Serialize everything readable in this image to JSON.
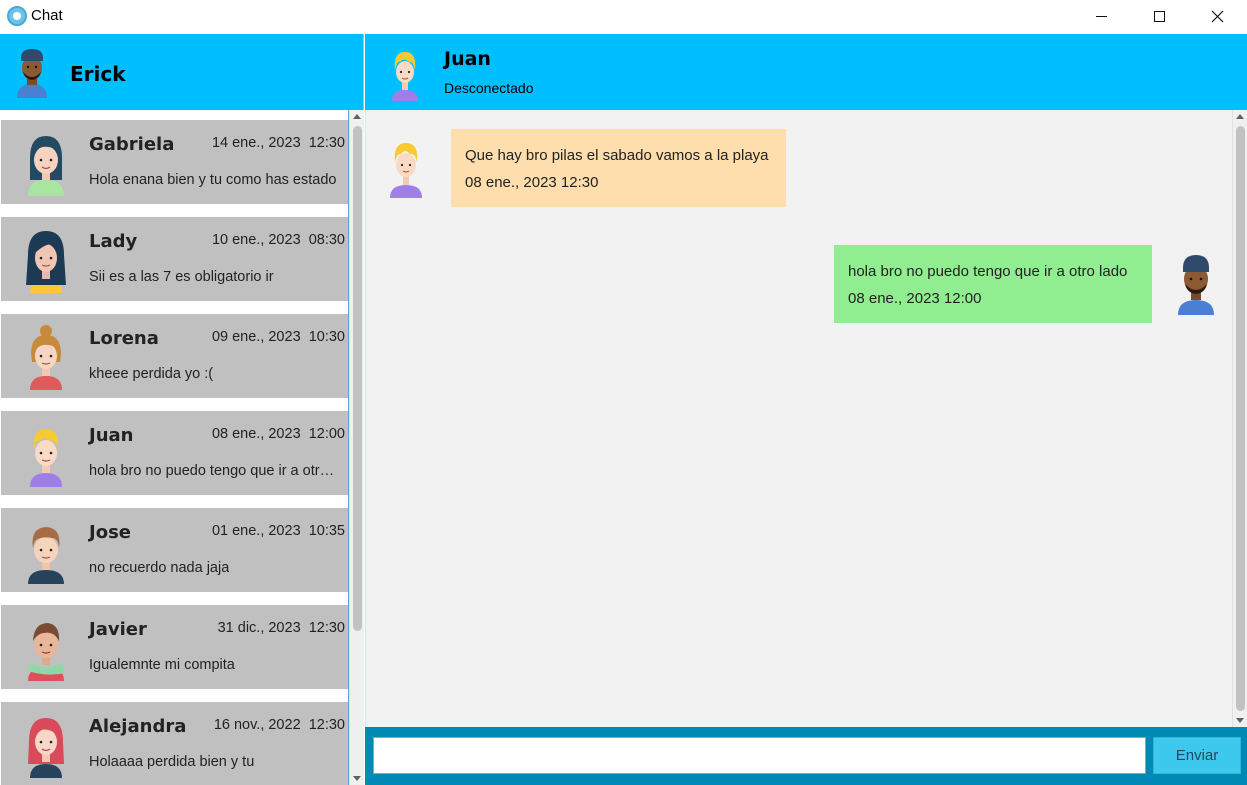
{
  "window": {
    "title": "Chat"
  },
  "current_user": {
    "name": "Erick",
    "avatar": "man-beanie-avatar"
  },
  "contacts": [
    {
      "name": "Gabriela",
      "date": "14 ene., 2023",
      "time": "12:30",
      "last_message": "Hola enana bien y tu como has estado",
      "avatar": "woman-dark-hair-avatar"
    },
    {
      "name": "Lady",
      "date": "10 ene., 2023",
      "time": "08:30",
      "last_message": "Sii es a las 7 es obligatorio ir",
      "avatar": "woman-long-hair-avatar"
    },
    {
      "name": "Lorena",
      "date": "09 ene., 2023",
      "time": "10:30",
      "last_message": "kheee perdida yo :(",
      "avatar": "woman-bun-avatar"
    },
    {
      "name": "Juan",
      "date": "08 ene., 2023",
      "time": "12:00",
      "last_message": "hola bro no puedo tengo que ir a otro ...",
      "avatar": "blond-man-avatar"
    },
    {
      "name": "Jose",
      "date": "01 ene., 2023",
      "time": "10:35",
      "last_message": "no recuerdo nada jaja",
      "avatar": "man-brown-hair-avatar"
    },
    {
      "name": "Javier",
      "date": "31 dic., 2023",
      "time": "12:30",
      "last_message": "Igualemnte mi compita",
      "avatar": "man-scarf-avatar"
    },
    {
      "name": "Alejandra",
      "date": "16 nov., 2022",
      "time": "12:30",
      "last_message": "Holaaaa perdida bien y tu",
      "avatar": "woman-red-hair-avatar"
    }
  ],
  "chat": {
    "peer_name": "Juan",
    "peer_status": "Desconectado",
    "messages": [
      {
        "direction": "incoming",
        "text": "Que hay bro pilas el sabado vamos a la playa",
        "timestamp": "08 ene., 2023  12:30",
        "color": "#ffdead"
      },
      {
        "direction": "outgoing",
        "text": "hola bro no puedo tengo que ir a otro lado",
        "timestamp": "08 ene., 2023  12:00",
        "color": "#90ee90"
      }
    ],
    "input_placeholder": "",
    "input_value": "",
    "send_label": "Enviar"
  },
  "colors": {
    "header": "#00bfff",
    "contact_bg": "#c0c0c0",
    "chat_bg": "#f2f2f2",
    "input_bar": "#0089b5",
    "send_button": "#3dc9ee"
  }
}
